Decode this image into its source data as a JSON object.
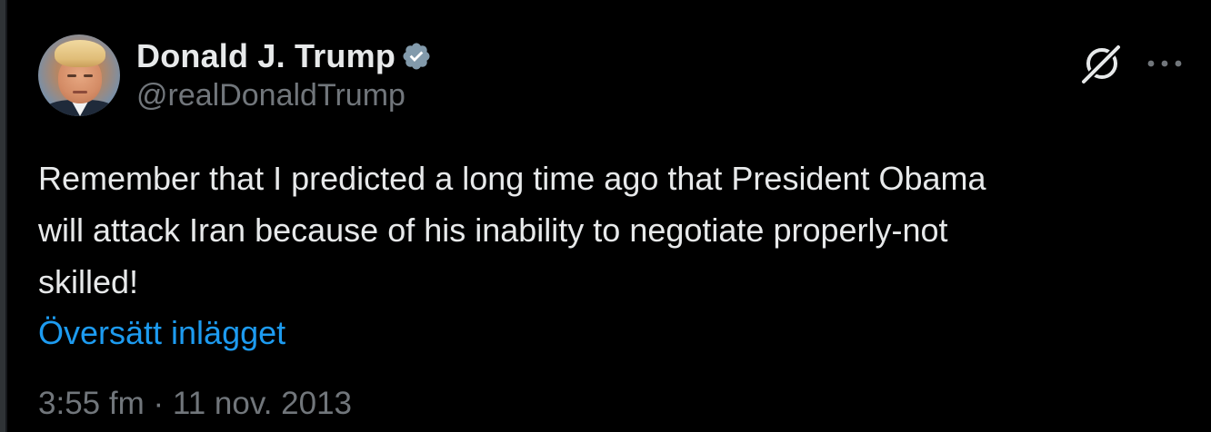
{
  "tweet": {
    "author": {
      "display_name": "Donald J. Trump",
      "handle": "@realDonaldTrump",
      "verified": true,
      "avatar_icon": "profile-photo"
    },
    "text": "Remember that I predicted a long time ago that President Obama\nwill attack Iran because of his inability to negotiate properly-not\nskilled!",
    "translate_label": "Översätt inlägget",
    "timestamp": "3:55 fm · 11 nov. 2013"
  },
  "actions": {
    "grok_icon": "grok-icon",
    "more_icon": "more-options-icon"
  },
  "colors": {
    "background": "#000000",
    "text_primary": "#e7e9ea",
    "text_secondary": "#71767b",
    "link": "#1d9bf0",
    "verified_badge": "#829aab"
  }
}
